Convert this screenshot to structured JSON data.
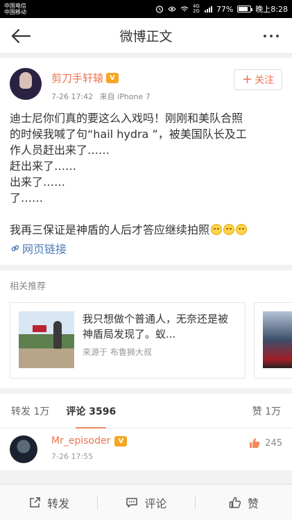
{
  "status_bar": {
    "carrier_1": "中国电信",
    "carrier_2": "中国移动",
    "network_1": "4G",
    "network_2": "2G",
    "battery": "77%",
    "battery_level": 0.77,
    "time": "晚上8:28"
  },
  "nav": {
    "title": "微博正文"
  },
  "post": {
    "author": "剪刀手轩辕",
    "time": "7-26 17:42",
    "source": "来自 iPhone 7",
    "follow_label": "关注",
    "lines": [
      "迪士尼你们真的要这么入戏吗！刚刚和美队合照",
      "的时候我喊了句“hail hydra ”，被美国队长及工",
      "作人员赶出来了……",
      "赶出来了……",
      "出来了……",
      "了……"
    ],
    "last_line": "我再三保证是神盾的人后才答应继续拍照",
    "link_label": "网页链接"
  },
  "related": {
    "title": "相关推荐",
    "card": {
      "text": "我只想做个普通人，无奈还是被神盾局发现了。蚁...",
      "source": "来源于  布鲁狮大叔"
    }
  },
  "tabs": {
    "repost": "转发 1万",
    "comment": "评论 3596",
    "like": "赞 1万"
  },
  "comment": {
    "name": "Mr_episoder",
    "time": "7-26 17:55",
    "likes": "245"
  },
  "bottom_bar": {
    "repost": "转发",
    "comment": "评论",
    "like": "赞"
  },
  "colors": {
    "accent": "#eb7350",
    "link": "#4a7ab8"
  }
}
